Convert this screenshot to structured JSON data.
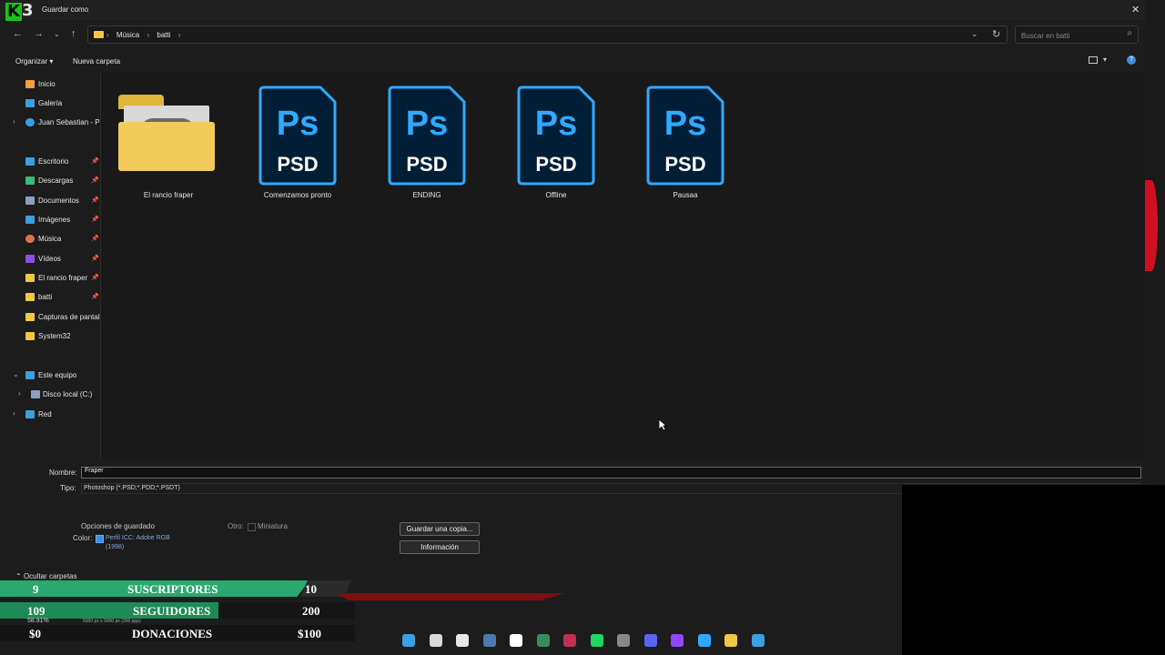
{
  "window": {
    "title": "Guardar como"
  },
  "address": {
    "crumbs": [
      "Música",
      "batti"
    ]
  },
  "search": {
    "placeholder": "Buscar en batti"
  },
  "toolbar": {
    "organize_label": "Organizar",
    "new_folder_label": "Nueva carpeta"
  },
  "sidebar": {
    "items": [
      {
        "label": "Inicio",
        "icon": "home-icon",
        "color": "#f0a040"
      },
      {
        "label": "Galería",
        "icon": "gallery-icon",
        "color": "#3aa0e0"
      },
      {
        "label": "Juan Sebastian - Pe",
        "icon": "cloud-icon",
        "color": "#3aa0e0"
      },
      {
        "label": "Escritorio",
        "icon": "desktop-icon",
        "color": "#3aa0e0"
      },
      {
        "label": "Descargas",
        "icon": "download-icon",
        "color": "#3cb878"
      },
      {
        "label": "Documentos",
        "icon": "documents-icon",
        "color": "#8aa0c0"
      },
      {
        "label": "Imágenes",
        "icon": "images-icon",
        "color": "#3aa0e0"
      },
      {
        "label": "Música",
        "icon": "music-icon",
        "color": "#e07050"
      },
      {
        "label": "Vídeos",
        "icon": "videos-icon",
        "color": "#8a50e0"
      },
      {
        "label": "El rancio fraper",
        "icon": "folder-icon",
        "color": "#f2c744"
      },
      {
        "label": "batti",
        "icon": "folder-icon",
        "color": "#f2c744"
      },
      {
        "label": "Capturas de pantall",
        "icon": "folder-icon",
        "color": "#f2c744"
      },
      {
        "label": "System32",
        "icon": "folder-icon",
        "color": "#f2c744"
      },
      {
        "label": "Este equipo",
        "icon": "computer-icon",
        "color": "#3aa0e0"
      },
      {
        "label": "Disco local (C:)",
        "icon": "drive-icon",
        "color": "#8aa0c0"
      },
      {
        "label": "Red",
        "icon": "network-icon",
        "color": "#3aa0e0"
      }
    ]
  },
  "files": [
    {
      "name": "El rancio fraper",
      "type": "folder"
    },
    {
      "name": "Comenzamos pronto",
      "type": "psd"
    },
    {
      "name": "ENDING",
      "type": "psd"
    },
    {
      "name": "Offline",
      "type": "psd"
    },
    {
      "name": "Pausaa",
      "type": "psd"
    }
  ],
  "psd_icon": {
    "top": "Ps",
    "bottom": "PSD",
    "accent": "#31a8ff",
    "bg": "#001e36"
  },
  "form": {
    "name_label": "Nombre:",
    "name_value": "Fraper",
    "type_label": "Tipo:",
    "type_value": "Photoshop (*.PSD;*.PDD;*.PSDT)",
    "save_options_label": "Opciones de guardado",
    "color_label": "Color:",
    "color_value": "Perfil ICC: Adobe RGB (1998)",
    "other_label": "Otro:",
    "thumbnail_label": "Miniatura",
    "save_copy_button": "Guardar una copia...",
    "info_button": "Información",
    "hide_folders_label": "Ocultar carpetas"
  },
  "overlay": {
    "rows": [
      {
        "left": "9",
        "label": "SUSCRIPTORES",
        "right": "10",
        "color": "#2aa870"
      },
      {
        "left": "109",
        "label": "SEGUIDORES",
        "right": "200",
        "color": "#1e8a58"
      },
      {
        "left": "$0",
        "label": "DONACIONES",
        "right": "$100",
        "color": "#1a1a1a"
      }
    ],
    "small_text_1": "58.91%",
    "small_text_2": "5000 px x 5000 px (300 ppp)"
  },
  "taskbar": {
    "icons": [
      {
        "name": "windows-start-icon",
        "color": "#3aa0e0"
      },
      {
        "name": "capture-app-icon",
        "color": "#d8d8d8"
      },
      {
        "name": "store-icon",
        "color": "#e8e8e8"
      },
      {
        "name": "steam-icon",
        "color": "#4a7ab0"
      },
      {
        "name": "tiktok-icon",
        "color": "#ffffff"
      },
      {
        "name": "notes-icon",
        "color": "#3a8a60"
      },
      {
        "name": "vivaldi-icon",
        "color": "#c03050"
      },
      {
        "name": "spotify-icon",
        "color": "#1ed760"
      },
      {
        "name": "chrome-like-icon",
        "color": "#888888"
      },
      {
        "name": "discord-icon",
        "color": "#5865f2"
      },
      {
        "name": "twitch-icon",
        "color": "#9146ff"
      },
      {
        "name": "photoshop-icon",
        "color": "#31a8ff"
      },
      {
        "name": "file-explorer-icon",
        "color": "#f2c744"
      },
      {
        "name": "photos-icon",
        "color": "#3aa0e0"
      }
    ]
  }
}
